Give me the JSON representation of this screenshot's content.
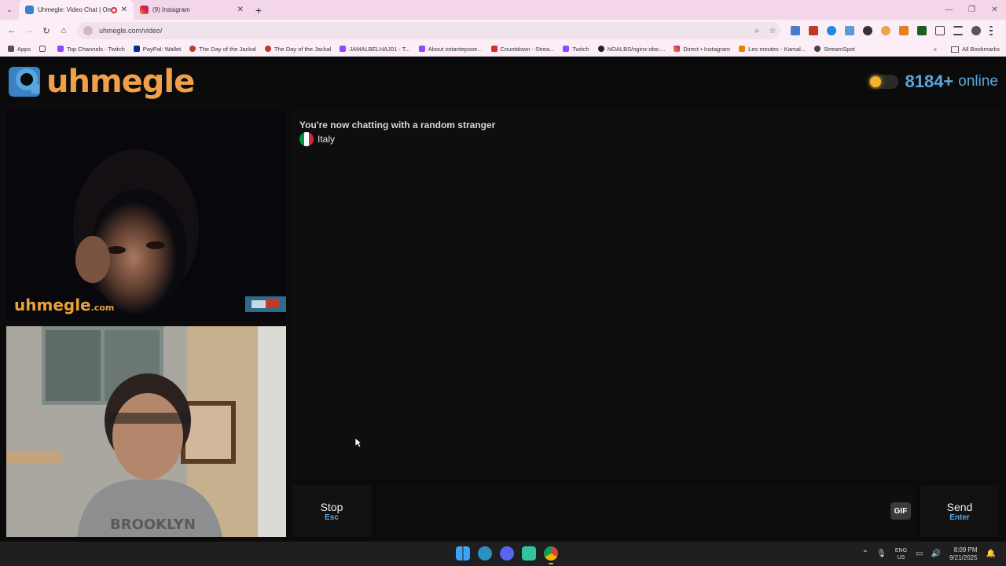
{
  "browser": {
    "tabs": [
      {
        "title": "Uhmegle: Video Chat | Ome",
        "active": true,
        "icon": "uhmegle-favicon"
      },
      {
        "title": "(9) Instagram",
        "active": false,
        "icon": "instagram-favicon"
      }
    ],
    "new_tab": "+",
    "url": "uhmegle.com/video/",
    "bookmarks": [
      {
        "label": "Apps",
        "icon": "apps-grid-icon"
      },
      {
        "label": "Top Channels - Twitch",
        "icon": "twitch-icon"
      },
      {
        "label": "PayPal: Wallet",
        "icon": "paypal-icon"
      },
      {
        "label": "The Day of the Jackal",
        "icon": "video-icon"
      },
      {
        "label": "The Day of the Jackal",
        "icon": "video-icon"
      },
      {
        "label": "JAMALBELHAJ01 - T...",
        "icon": "twitch-icon"
      },
      {
        "label": "About votantepsoe...",
        "icon": "twitch-icon"
      },
      {
        "label": "Countdown - Strea...",
        "icon": "dps-icon"
      },
      {
        "label": "Twitch",
        "icon": "twitch-icon"
      },
      {
        "label": "NOALBS/nginx-obs-...",
        "icon": "github-icon"
      },
      {
        "label": "Direct • Instagram",
        "icon": "instagram-icon"
      },
      {
        "label": "Les meutes - Kamal...",
        "icon": "blogger-icon"
      },
      {
        "label": "StreamSpot",
        "icon": "globe-icon"
      }
    ],
    "all_bookmarks": "All Bookmarks"
  },
  "site": {
    "logo_text": "uhmegle",
    "online_count": "8184+",
    "online_label": "online",
    "watermark": "uhmegle",
    "watermark_suffix": ".com"
  },
  "chat": {
    "status": "You're now chatting with a random stranger",
    "country": "Italy",
    "input_value": "",
    "stop_label": "Stop",
    "stop_key": "Esc",
    "gif_label": "GIF",
    "send_label": "Send",
    "send_key": "Enter"
  },
  "taskbar": {
    "lang_top": "ENG",
    "lang_bottom": "US",
    "time": "8:09 PM",
    "date": "9/21/2025"
  },
  "colors": {
    "brand_orange": "#f0a04b",
    "brand_blue": "#5aa7e0",
    "background": "#0b0b0b"
  }
}
